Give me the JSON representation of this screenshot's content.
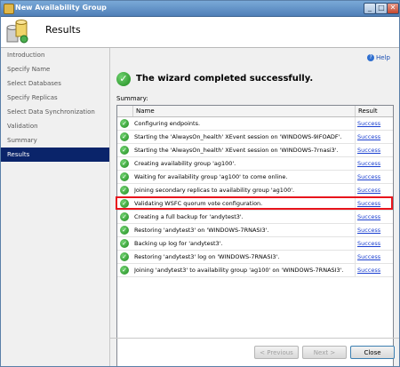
{
  "window": {
    "title": "New Availability Group"
  },
  "header": {
    "title": "Results"
  },
  "sidebar": {
    "items": [
      {
        "label": "Introduction"
      },
      {
        "label": "Specify Name"
      },
      {
        "label": "Select Databases"
      },
      {
        "label": "Specify Replicas"
      },
      {
        "label": "Select Data Synchronization"
      },
      {
        "label": "Validation"
      },
      {
        "label": "Summary"
      },
      {
        "label": "Results",
        "active": true
      }
    ]
  },
  "main": {
    "help_label": "Help",
    "success_message": "The wizard completed successfully.",
    "summary_label": "Summary:",
    "columns": {
      "name": "Name",
      "result": "Result"
    },
    "rows": [
      {
        "name": "Configuring endpoints.",
        "result": "Success"
      },
      {
        "name": "Starting the 'AlwaysOn_health' XEvent session on 'WINDOWS-9IFOADF'.",
        "result": "Success"
      },
      {
        "name": "Starting the 'AlwaysOn_health' XEvent session on 'WINDOWS-7rnasi3'.",
        "result": "Success"
      },
      {
        "name": "Creating availability group 'ag100'.",
        "result": "Success"
      },
      {
        "name": "Waiting for availability group 'ag100' to come online.",
        "result": "Success"
      },
      {
        "name": "Joining secondary replicas to availability group 'ag100'.",
        "result": "Success"
      },
      {
        "name": "Validating WSFC quorum vote configuration.",
        "result": "Success",
        "highlighted": true
      },
      {
        "name": "Creating a full backup for 'andytest3'.",
        "result": "Success"
      },
      {
        "name": "Restoring 'andytest3' on 'WINDOWS-7RNASI3'.",
        "result": "Success"
      },
      {
        "name": "Backing up log for 'andytest3'.",
        "result": "Success"
      },
      {
        "name": "Restoring 'andytest3' log on 'WINDOWS-7RNASI3'.",
        "result": "Success"
      },
      {
        "name": "Joining 'andytest3' to availability group 'ag100' on 'WINDOWS-7RNASI3'.",
        "result": "Success"
      }
    ]
  },
  "footer": {
    "previous_label": "< Previous",
    "next_label": "Next >",
    "close_label": "Close"
  },
  "colors": {
    "highlight": "#e8141c",
    "selected_nav": "#0a246a",
    "link": "#1a3fd0"
  }
}
